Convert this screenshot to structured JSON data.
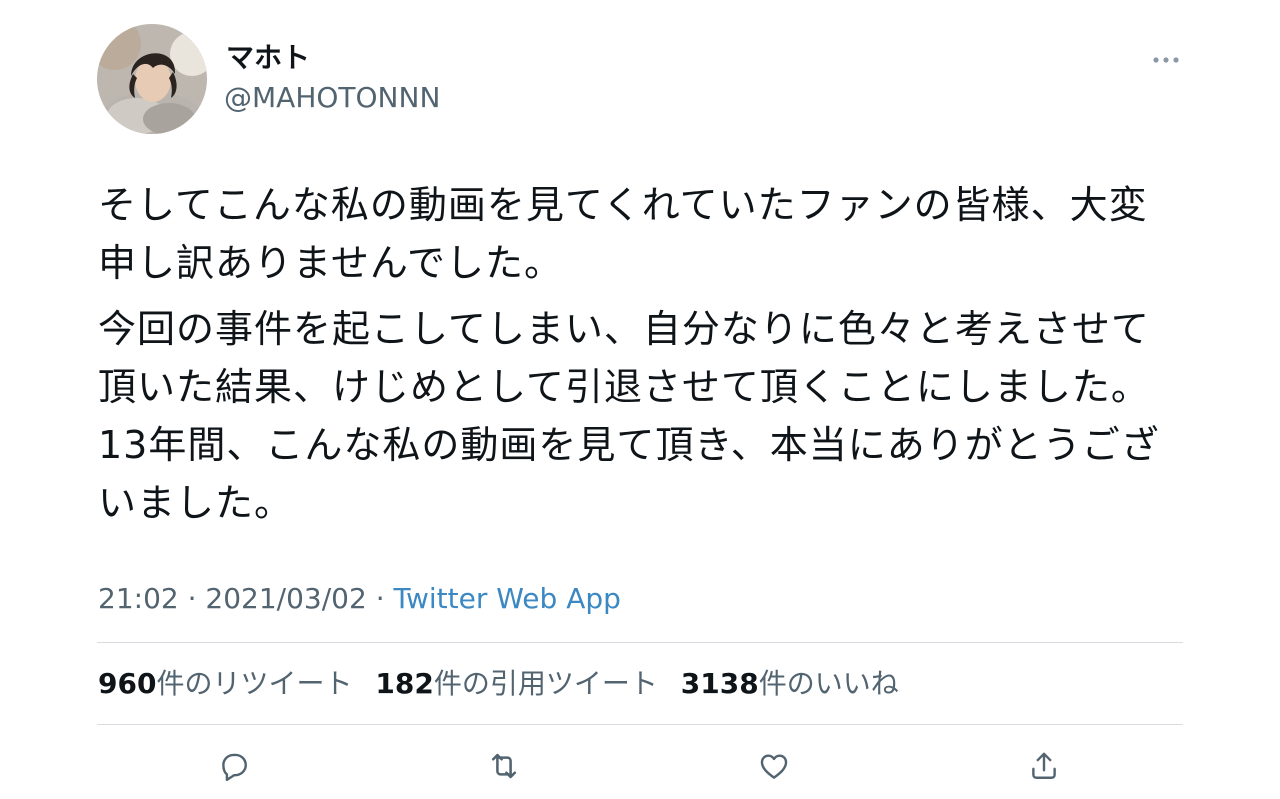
{
  "author": {
    "display_name": "マホト",
    "handle": "@MAHOTONNN"
  },
  "tweet": {
    "paragraphs": [
      [
        "そしてこんな私の動画を見てくれていたファンの皆様、大変",
        "申し訳ありませんでした。"
      ],
      [
        "今回の事件を起こしてしまい、自分なりに色々と考えさせて",
        "頂いた結果、けじめとして引退させて頂くことにしました。",
        "13年間、こんな私の動画を見て頂き、本当にありがとうござ",
        "いました。"
      ]
    ]
  },
  "meta": {
    "time": "21:02",
    "separator1": " · ",
    "date": "2021/03/02",
    "separator2": " · ",
    "source": "Twitter Web App"
  },
  "stats": {
    "retweets_count": "960",
    "retweets_label": "件のリツイート",
    "quotes_count": "182",
    "quotes_label": "件の引用ツイート",
    "likes_count": "3138",
    "likes_label": "件のいいね"
  },
  "icons": {
    "more": "more-horizontal-icon",
    "reply": "reply-icon",
    "retweet": "retweet-icon",
    "like": "heart-icon",
    "share": "share-icon"
  },
  "colors": {
    "text": "#0f1419",
    "secondary": "#536471",
    "link": "#3b88c3",
    "divider": "#d9dde1",
    "icon": "#536471"
  }
}
